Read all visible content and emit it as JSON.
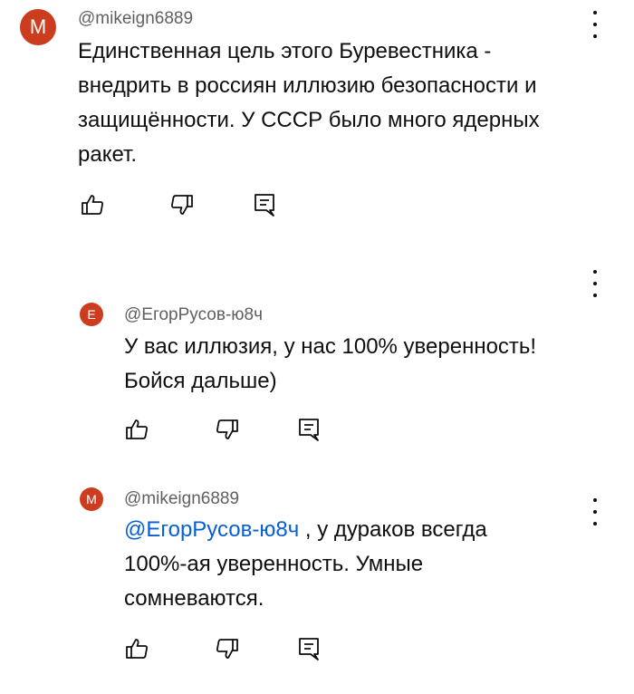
{
  "comments": [
    {
      "avatar_letter": "M",
      "author": "@mikeign6889",
      "text_lines": [
        "Единственная цель этого Буревестника -",
        "внедрить в россиян иллюзию безопасности и",
        "защищённости. У СССР было много ядерных",
        "ракет."
      ]
    },
    {
      "avatar_letter": "E",
      "author": "@ЕгорРусов-ю8ч",
      "text_lines": [
        "У вас иллюзия, у нас 100% уверенность!",
        "Бойся дальше)"
      ]
    },
    {
      "avatar_letter": "M",
      "author": "@mikeign6889",
      "mention": "@ЕгорРусов-ю8ч",
      "text_first_rest": " , у дураков всегда",
      "text_lines": [
        "100%-ая уверенность. Умные",
        "сомневаются."
      ]
    }
  ],
  "icons": {
    "like": "thumbs-up-icon",
    "dislike": "thumbs-down-icon",
    "reply": "reply-icon",
    "more": "more-vert-icon"
  },
  "colors": {
    "avatar": "#cc3d1f",
    "mention": "#065fd4",
    "secondary_text": "#606060"
  }
}
